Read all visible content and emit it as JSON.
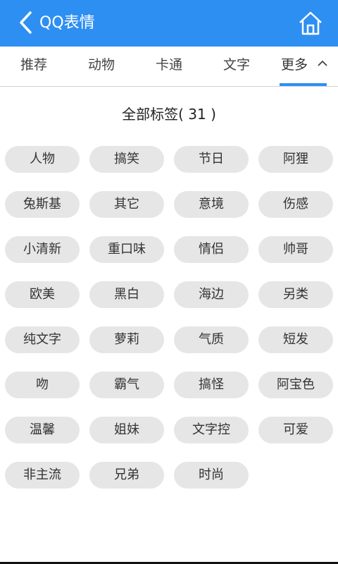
{
  "header": {
    "title": "QQ表情",
    "back_icon": "chevron-left-icon",
    "home_icon": "home-icon",
    "color": "#2e8ff2"
  },
  "tabs": [
    {
      "label": "推荐"
    },
    {
      "label": "动物"
    },
    {
      "label": "卡通"
    },
    {
      "label": "文字"
    },
    {
      "label": "更多",
      "active": true,
      "icon": "chevron-up-icon"
    }
  ],
  "section": {
    "title": "全部标签( 31 )"
  },
  "tags": [
    "人物",
    "搞笑",
    "节日",
    "阿狸",
    "兔斯基",
    "其它",
    "意境",
    "伤感",
    "小清新",
    "重口味",
    "情侣",
    "帅哥",
    "欧美",
    "黑白",
    "海边",
    "另类",
    "纯文字",
    "萝莉",
    "气质",
    "短发",
    "吻",
    "霸气",
    "搞怪",
    "阿宝色",
    "温馨",
    "姐妹",
    "文字控",
    "可爱",
    "非主流",
    "兄弟",
    "时尚"
  ]
}
